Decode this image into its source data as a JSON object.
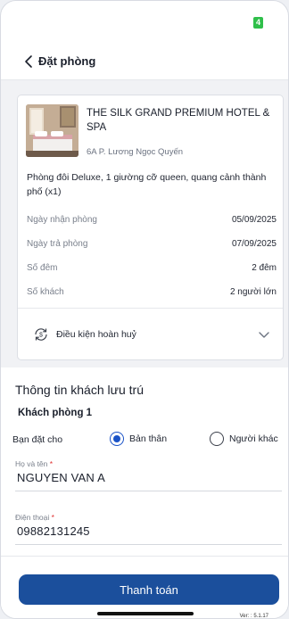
{
  "status_bar": {
    "battery_text": "4"
  },
  "header": {
    "title": "Đặt phòng"
  },
  "hotel": {
    "name": "THE SILK GRAND PREMIUM HOTEL & SPA",
    "address": "6A P. Lương Ngọc Quyến",
    "room_description": "Phòng đôi Deluxe, 1 giường cỡ queen, quang cảnh thành phố (x1)"
  },
  "booking_info": [
    {
      "label": "Ngày nhận phòng",
      "value": "05/09/2025"
    },
    {
      "label": "Ngày trả phòng",
      "value": "07/09/2025"
    },
    {
      "label": "Số đêm",
      "value": "2 đêm"
    },
    {
      "label": "Số khách",
      "value": "2 người lớn"
    }
  ],
  "cancellation": {
    "label": "Điều kiện hoàn huỷ"
  },
  "guest_section": {
    "title": "Thông tin khách lưu trú",
    "room_subtitle": "Khách phòng 1",
    "book_for_label": "Bạn đặt cho",
    "options": [
      {
        "label": "Bản thân",
        "selected": true
      },
      {
        "label": "Người khác",
        "selected": false
      }
    ],
    "name_field": {
      "label": "Họ và tên",
      "required_mark": "*",
      "value": "NGUYEN VAN A"
    },
    "phone_field": {
      "label": "Điện thoại",
      "required_mark": "*",
      "value": "09882131245"
    }
  },
  "footer": {
    "pay_button_label": "Thanh toán",
    "version": "Ver: : 5.1.17"
  },
  "colors": {
    "primary": "#1b4f9c",
    "radio_selected": "#1b53c7",
    "battery": "#2fbf4a",
    "required": "#e03131"
  },
  "icons": {
    "back": "chevron-left-icon",
    "cancellation": "refresh-dollar-icon",
    "expand": "chevron-down-icon"
  }
}
